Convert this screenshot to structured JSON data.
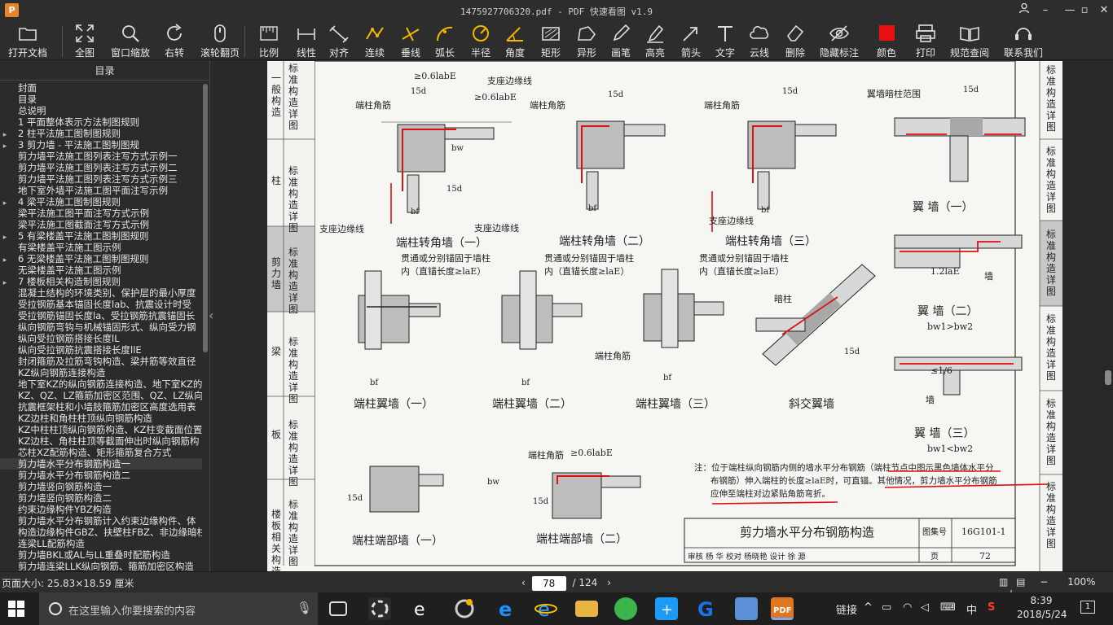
{
  "window": {
    "title": "1475927706320.pdf - PDF 快速看图 v1.9",
    "app_icon_letter": "P",
    "buttons": [
      "user",
      "minimize",
      "maximize",
      "close"
    ]
  },
  "toolbar": {
    "items": [
      {
        "label": "打开文档",
        "icon": "folder-icon"
      },
      {
        "label": "全图",
        "icon": "fullscreen-icon"
      },
      {
        "label": "窗口缩放",
        "icon": "zoom-icon"
      },
      {
        "label": "右转",
        "icon": "rotate-right-icon"
      },
      {
        "label": "滚轮翻页",
        "icon": "mouse-icon"
      },
      {
        "label": "比例",
        "icon": "ruler-icon"
      },
      {
        "label": "线性",
        "icon": "linear-dimension-icon"
      },
      {
        "label": "对齐",
        "icon": "aligned-dimension-icon"
      },
      {
        "label": "连续",
        "icon": "continuous-dimension-icon"
      },
      {
        "label": "垂线",
        "icon": "perpendicular-icon"
      },
      {
        "label": "弧长",
        "icon": "arc-length-icon"
      },
      {
        "label": "半径",
        "icon": "radius-icon"
      },
      {
        "label": "角度",
        "icon": "angle-icon"
      },
      {
        "label": "矩形",
        "icon": "rectangle-icon"
      },
      {
        "label": "异形",
        "icon": "polygon-icon"
      },
      {
        "label": "画笔",
        "icon": "pen-icon"
      },
      {
        "label": "高亮",
        "icon": "highlight-icon"
      },
      {
        "label": "箭头",
        "icon": "arrow-icon"
      },
      {
        "label": "文字",
        "icon": "text-icon"
      },
      {
        "label": "云线",
        "icon": "cloud-icon"
      },
      {
        "label": "删除",
        "icon": "eraser-icon"
      },
      {
        "label": "隐藏标注",
        "icon": "hide-icon"
      },
      {
        "label": "颜色",
        "icon": "color-icon"
      },
      {
        "label": "打印",
        "icon": "print-icon"
      },
      {
        "label": "规范查阅",
        "icon": "book-icon"
      },
      {
        "label": "联系我们",
        "icon": "support-icon"
      }
    ],
    "color_swatch": "#e81010"
  },
  "sidebar": {
    "header": "目录",
    "items": [
      {
        "label": "封面",
        "expand": false
      },
      {
        "label": "目录",
        "expand": false
      },
      {
        "label": "总说明",
        "expand": false
      },
      {
        "label": "1 平面整体表示方法制图规则",
        "expand": false
      },
      {
        "label": "2 柱平法施工图制图规则",
        "expand": true
      },
      {
        "label": "3 剪力墙 - 平法施工图制图规",
        "expand": true
      },
      {
        "label": "剪力墙平法施工图列表注写方式示例一",
        "expand": false
      },
      {
        "label": "剪力墙平法施工图列表注写方式示例二",
        "expand": false
      },
      {
        "label": "剪力墙平法施工图列表注写方式示例三",
        "expand": false
      },
      {
        "label": "地下室外墙平法施工图平面注写示例",
        "expand": false
      },
      {
        "label": "4 梁平法施工图制图规则",
        "expand": true
      },
      {
        "label": "梁平法施工图平面注写方式示例",
        "expand": false
      },
      {
        "label": "梁平法施工图截面注写方式示例",
        "expand": false
      },
      {
        "label": "5 有梁楼盖平法施工图制图规则",
        "expand": true
      },
      {
        "label": "有梁楼盖平法施工图示例",
        "expand": false
      },
      {
        "label": "6 无梁楼盖平法施工图制图规则",
        "expand": true
      },
      {
        "label": "无梁楼盖平法施工图示例",
        "expand": false
      },
      {
        "label": "7 楼板相关构造制图规则",
        "expand": true
      },
      {
        "label": "混凝土结构的环境类别、保护层的最小厚度",
        "expand": false
      },
      {
        "label": "受拉钢筋基本锚固长度lab、抗震设计时受",
        "expand": false
      },
      {
        "label": "受拉钢筋锚固长度la、受拉钢筋抗震锚固长",
        "expand": false
      },
      {
        "label": "纵向钢筋弯钩与机械锚固形式、纵向受力钢",
        "expand": false
      },
      {
        "label": "纵向受拉钢筋搭接长度lL",
        "expand": false
      },
      {
        "label": "纵向受拉钢筋抗震搭接长度llE",
        "expand": false
      },
      {
        "label": "封闭箍筋及拉筋弯钩构造、梁并筋等效直径",
        "expand": false
      },
      {
        "label": "KZ纵向钢筋连接构造",
        "expand": false
      },
      {
        "label": "地下室KZ的纵向钢筋连接构造、地下室KZ的",
        "expand": false
      },
      {
        "label": "KZ、QZ、LZ箍筋加密区范围、QZ、LZ纵向钢",
        "expand": false
      },
      {
        "label": "抗震框架柱和小墙肢箍筋加密区高度选用表",
        "expand": false
      },
      {
        "label": "KZ边柱和角柱柱顶纵向钢筋构造",
        "expand": false
      },
      {
        "label": "KZ中柱柱顶纵向钢筋构造、KZ柱变截面位置",
        "expand": false
      },
      {
        "label": "KZ边柱、角柱柱顶等截面伸出时纵向钢筋构",
        "expand": false
      },
      {
        "label": "芯柱XZ配筋构造、矩形箍筋复合方式",
        "expand": false
      },
      {
        "label": "剪力墙水平分布钢筋构造一",
        "expand": false,
        "selected": true
      },
      {
        "label": "剪力墙水平分布钢筋构造二",
        "expand": false
      },
      {
        "label": "剪力墙竖向钢筋构造一",
        "expand": false
      },
      {
        "label": "剪力墙竖向钢筋构造二",
        "expand": false
      },
      {
        "label": "约束边缘构件YBZ构造",
        "expand": false
      },
      {
        "label": "剪力墙水平分布钢筋计入约束边缘构件、体",
        "expand": false
      },
      {
        "label": "构造边缘构件GBZ、扶壁柱FBZ、非边缘暗柱",
        "expand": false
      },
      {
        "label": "连梁LL配筋构造",
        "expand": false
      },
      {
        "label": "剪力墙BKL或AL与LL重叠时配筋构造",
        "expand": false
      },
      {
        "label": "剪力墙连梁LLK纵向钢筋、箍筋加密区构造",
        "expand": false
      }
    ]
  },
  "drawing": {
    "left_tabs": [
      {
        "label": "一般构造",
        "sub": "标准构造详图"
      },
      {
        "label": "柱",
        "sub": "标准构造详图"
      },
      {
        "label": "剪力墙",
        "sub": "标准构造详图"
      },
      {
        "label": "梁",
        "sub": "标准构造详图"
      },
      {
        "label": "板",
        "sub": "标准构造详图"
      },
      {
        "label": "楼板相关构造",
        "sub": "标准构造详图"
      }
    ],
    "right_tabs": [
      "标准构造详图",
      "标准构造详图",
      "标准构造详图",
      "标准构造详图",
      "标准构造详图",
      "标准构造详图"
    ],
    "captions": {
      "c1": "端柱转角墙（一）",
      "c2": "端柱转角墙（二）",
      "c3": "端柱转角墙（三）",
      "c4": "翼 墙（一）",
      "c5": "端柱翼墙（一）",
      "c6": "端柱翼墙（二）",
      "c7": "端柱翼墙（三）",
      "c8": "斜交翼墙",
      "c9": "翼 墙（二）",
      "c10": "翼 墙（三）",
      "c11": "端柱端部墙（一）",
      "c12": "端柱端部墙（二）"
    },
    "labels": {
      "corner_bar": "端柱角筋",
      "support_line": "支座边缘线",
      "wing_range": "翼墙暗柱范围",
      "hidden_col": "暗柱",
      "wall": "墙",
      "through_anchor_1": "贯通或分别锚固于墙柱",
      "through_anchor_2": "内（直锚长度≥laE）",
      "len_06": "≥0.6labE",
      "d15": "15d",
      "bw": "bw",
      "bf": "bf",
      "bw1_gt": "bw1>bw2",
      "bw1_lt": "bw1<bw2",
      "len_12": "1.2laE",
      "ratio": "≤1/6"
    },
    "note": {
      "line1": "注：位于端柱纵向钢筋内侧的墙水平分布钢筋（端柱节点中图示黑色墙体水平分",
      "line2": "布钢筋）伸入端柱的长度≥laE时，可直锚。其他情况，剪力墙水平分布钢筋",
      "line3": "应伸至端柱对边紧贴角筋弯折。"
    },
    "titleblock": {
      "title": "剪力墙水平分布钢筋构造",
      "atlas_label": "图集号",
      "atlas": "16G101-1",
      "row2": "审核 杨 华 校对 杨晓艳 设计 徐 源",
      "page_label": "页",
      "page": "72"
    }
  },
  "statusbar": {
    "page_size": "页面大小: 25.83×18.59 厘米",
    "current_page": "78",
    "total_pages": "/ 124",
    "zoom": "100%"
  },
  "taskbar": {
    "search_placeholder": "在这里输入你要搜索的内容",
    "tray_link": "链接",
    "ime": "中",
    "time": "8:39",
    "date": "2018/5/24",
    "notif_count": "1"
  }
}
